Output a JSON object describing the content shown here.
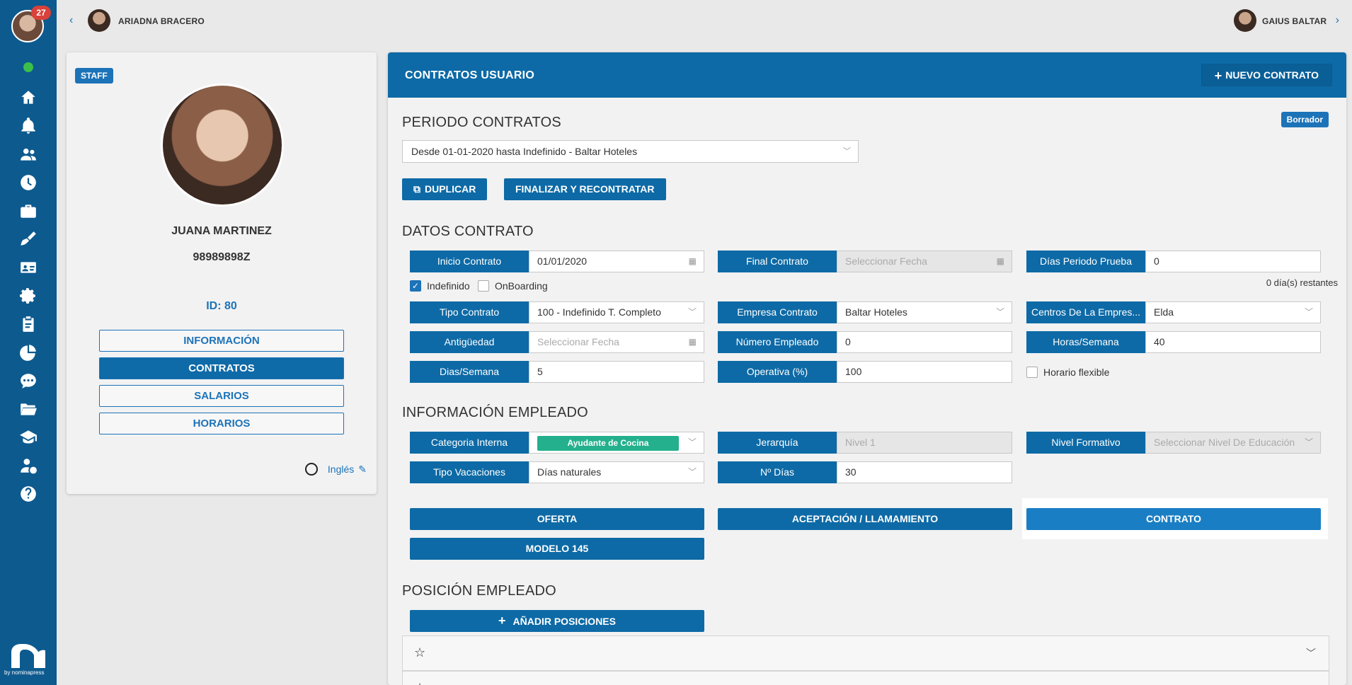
{
  "sidebar": {
    "notification_count": "27",
    "nav_icons": [
      "home-icon",
      "bell-icon",
      "users-icon",
      "clock-icon",
      "briefcase-icon",
      "tools-icon",
      "id-card-icon",
      "gear-icon",
      "clipboard-icon",
      "pie-chart-icon",
      "chat-icon",
      "folder-icon",
      "graduation-cap-icon",
      "payroll-user-icon",
      "help-icon"
    ],
    "logo_text": "by nominapress"
  },
  "topbar": {
    "prev_user": "ARIADNA BRACERO",
    "next_user": "GAIUS BALTAR"
  },
  "profile": {
    "tag": "STAFF",
    "name": "JUANA MARTINEZ",
    "dni": "98989898Z",
    "id": "ID: 80",
    "buttons": [
      "INFORMACIÓN",
      "CONTRATOS",
      "SALARIOS",
      "HORARIOS"
    ],
    "active_button": "CONTRATOS",
    "language": "Inglés"
  },
  "panel": {
    "title": "CONTRATOS USUARIO",
    "new_button": "NUEVO CONTRATO",
    "status": "Borrador",
    "periodo": {
      "heading": "PERIODO CONTRATOS",
      "selected": "Desde 01-01-2020 hasta Indefinido - Baltar Hoteles",
      "duplicate": "DUPLICAR",
      "finalize": "FINALIZAR Y RECONTRATAR"
    },
    "datos": {
      "heading": "DATOS CONTRATO",
      "inicio_label": "Inicio Contrato",
      "inicio_value": "01/01/2020",
      "final_label": "Final Contrato",
      "final_placeholder": "Seleccionar Fecha",
      "prueba_label": "Días Periodo Prueba",
      "prueba_value": "0",
      "indefinido": "Indefinido",
      "onboarding": "OnBoarding",
      "restantes": "0 día(s) restantes",
      "tipo_label": "Tipo Contrato",
      "tipo_value": "100 - Indefinido T. Completo",
      "empresa_label": "Empresa Contrato",
      "empresa_value": "Baltar Hoteles",
      "centros_label": "Centros De La Empres...",
      "centros_value": "Elda",
      "antig_label": "Antigüedad",
      "antig_placeholder": "Seleccionar Fecha",
      "numemp_label": "Número Empleado",
      "numemp_value": "0",
      "horas_label": "Horas/Semana",
      "horas_value": "40",
      "dias_label": "Dias/Semana",
      "dias_value": "5",
      "operativa_label": "Operativa (%)",
      "operativa_value": "100",
      "flexible": "Horario flexible"
    },
    "info": {
      "heading": "INFORMACIÓN EMPLEADO",
      "categoria_label": "Categoria Interna",
      "categoria_value": "Ayudante de Cocina",
      "jerarquia_label": "Jerarquía",
      "jerarquia_value": "Nivel 1",
      "nivel_label": "Nivel Formativo",
      "nivel_placeholder": "Seleccionar Nivel De Educación",
      "vacaciones_label": "Tipo Vacaciones",
      "vacaciones_value": "Días naturales",
      "ndias_label": "Nº Días",
      "ndias_value": "30",
      "docs": [
        "OFERTA",
        "ACEPTACIÓN / LLAMAMIENTO",
        "CONTRATO",
        "MODELO 145"
      ]
    },
    "posicion": {
      "heading": "POSICIÓN EMPLEADO",
      "add_button": "AÑADIR POSICIONES"
    }
  },
  "colors": {
    "primary": "#0d6aa6",
    "sidebar": "#0d5a8f",
    "accent": "#1d73b8",
    "chip": "#24b08d",
    "badge": "#d9413a"
  }
}
